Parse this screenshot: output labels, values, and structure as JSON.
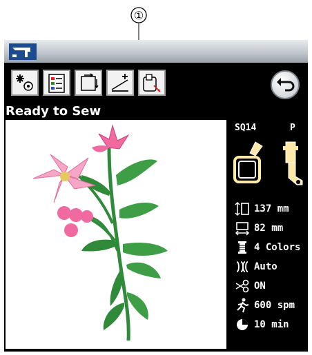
{
  "callout": {
    "number": "①"
  },
  "toolbar": {
    "buttons": [
      {
        "name": "thread-colors-button",
        "icon": "flower-stitch-icon"
      },
      {
        "name": "color-list-button",
        "icon": "color-list-icon"
      },
      {
        "name": "trace-button",
        "icon": "trace-frame-icon"
      },
      {
        "name": "jog-position-button",
        "icon": "jog-adjust-icon"
      },
      {
        "name": "hoop-position-button",
        "icon": "hoop-move-icon"
      }
    ]
  },
  "status": {
    "text": "Ready to Sew"
  },
  "hoop": {
    "label": "SQ14"
  },
  "foot": {
    "label": "P"
  },
  "info": {
    "height": "137 mm",
    "width": "82 mm",
    "colors": "4 Colors",
    "thread_cut": "Auto",
    "jump_cut": "ON",
    "speed": "600 spm",
    "time": "10 min"
  },
  "colors": {
    "screen_bg": "#000000",
    "petal_pink": "#f06aa0",
    "petal_light": "#f6a6c6",
    "stem_green": "#2f8a3a",
    "leaf_green": "#3d9e45",
    "center_yellow": "#e6c860"
  }
}
